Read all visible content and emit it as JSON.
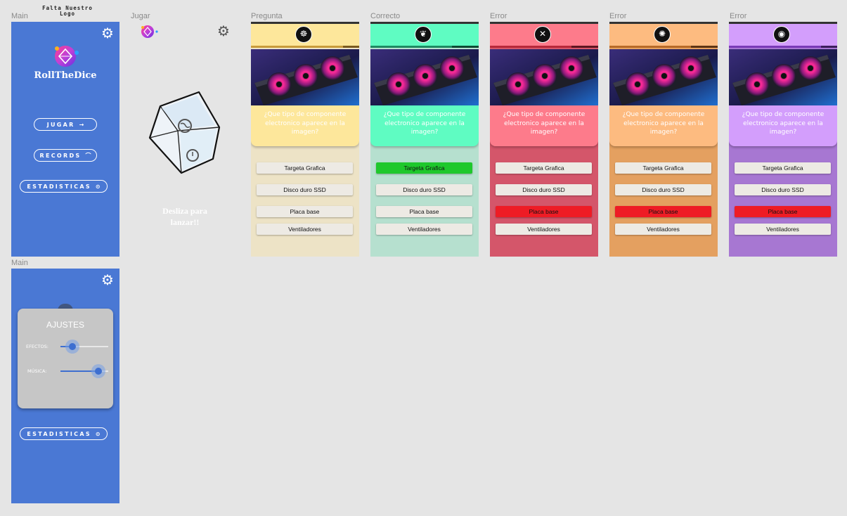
{
  "frame_labels": [
    "Main",
    "Jugar",
    "Pregunta",
    "Correcto",
    "Error",
    "Error",
    "Error",
    "Main"
  ],
  "logo_note": "Falta Nuestro Logo",
  "main": {
    "app_name": "RollTheDice",
    "buttons": [
      {
        "label": "JUGAR",
        "icon": "→"
      },
      {
        "label": "RECORDS",
        "icon": "⌒"
      },
      {
        "label": "ESTADISTICAS",
        "icon": "⊙"
      }
    ]
  },
  "jugar": {
    "tagline": "Desliza para lanzar!!"
  },
  "question": "¿Que tipo de componente electronico aparece en la imagen?",
  "answers": [
    "Targeta Grafica",
    "Disco duro SSD",
    "Placa base",
    "Ventiladores"
  ],
  "cards": [
    {
      "header": "#fde79b",
      "bar_fill": "#c89b3a",
      "bar_track": "#7a5a1e",
      "progress": 0.85,
      "icon": "☸",
      "qbox": "#fde79b",
      "panel": "#ede3c6",
      "answer_colors": [
        "#edeae4",
        "#edeae4",
        "#edeae4",
        "#edeae4"
      ]
    },
    {
      "header": "#5ffcc2",
      "bar_fill": "#1e8a62",
      "bar_track": "#0c4a33",
      "progress": 0.75,
      "icon": "❦",
      "qbox": "#5ffcc2",
      "panel": "#b6e0cf",
      "answer_colors": [
        "#1ec82c",
        "#edeae4",
        "#edeae4",
        "#edeae4"
      ]
    },
    {
      "header": "#fd7b8b",
      "bar_fill": "#b8283a",
      "bar_track": "#5e1520",
      "progress": 0.75,
      "icon": "✕",
      "qbox": "#fd7b8b",
      "panel": "#d4566a",
      "answer_colors": [
        "#edeae4",
        "#edeae4",
        "#ee1c25",
        "#edeae4"
      ]
    },
    {
      "header": "#fdbb80",
      "bar_fill": "#b86a28",
      "bar_track": "#5e3414",
      "progress": 0.75,
      "icon": "✺",
      "qbox": "#fdbb80",
      "panel": "#e4a060",
      "answer_colors": [
        "#edeae4",
        "#edeae4",
        "#ee1c25",
        "#edeae4"
      ]
    },
    {
      "header": "#d39efc",
      "bar_fill": "#7a3ab8",
      "bar_track": "#3e1e5e",
      "progress": 0.85,
      "icon": "◉",
      "qbox": "#d39efc",
      "panel": "#a777d2",
      "answer_colors": [
        "#edeae4",
        "#edeae4",
        "#ee1c25",
        "#edeae4"
      ]
    }
  ],
  "settings": {
    "title": "AJUSTES",
    "sliders": [
      {
        "label": "EFECTOS:",
        "value": 0.25
      },
      {
        "label": "MÚSICA:",
        "value": 0.8
      }
    ],
    "button": {
      "label": "ESTADISTICAS",
      "icon": "⊙"
    }
  },
  "colors": {
    "main_blue": "#4a78d4",
    "slider_blue": "#3e6fd0"
  },
  "icons": [
    "gear-icon",
    "dice-logo-icon",
    "arrow-right-icon",
    "gauge-icon",
    "stats-icon",
    "category-icon",
    "gpu-image"
  ]
}
